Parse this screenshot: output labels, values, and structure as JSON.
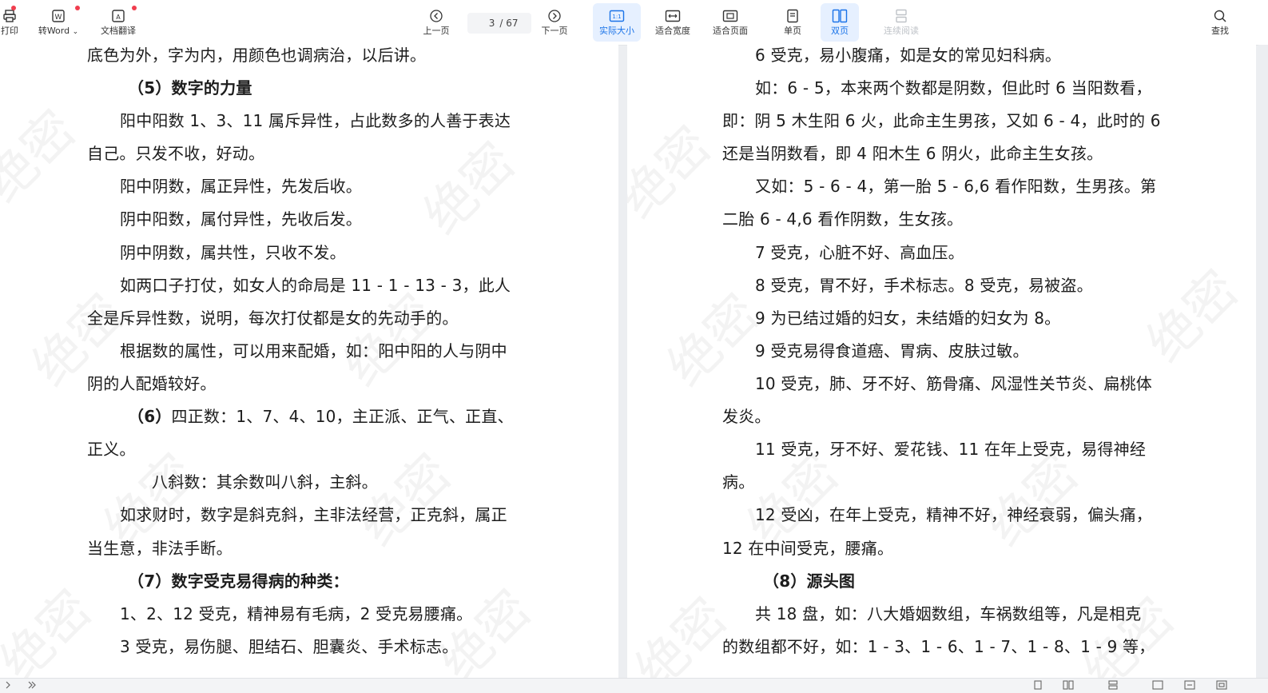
{
  "toolbar": {
    "print": "打印",
    "to_word": "转Word",
    "translate": "文档翻译",
    "prev_page": "上一页",
    "page_current": "3",
    "page_total": "/ 67",
    "next_page": "下一页",
    "actual_size": "实际大小",
    "fit_width": "适合宽度",
    "fit_page": "适合页面",
    "single_page": "单页",
    "double_page": "双页",
    "continuous": "连续阅读",
    "find": "查找"
  },
  "watermark": "绝密",
  "left_page": {
    "lines": [
      "底色为外，字为内，用颜色也调病治，以后讲。",
      "（5）数字的力量",
      "阳中阳数 1、3、11 属斥异性，占此数多的人善于表达",
      "自己。只发不收，好动。",
      "阳中阴数，属正异性，先发后收。",
      "阴中阳数，属付异性，先收后发。",
      "阴中阴数，属共性，只收不发。",
      "如两口子打仗，如女人的命局是 11 - 1 - 13 - 3，此人",
      "全是斥异性数，说明，每次打仗都是女的先动手的。",
      "根据数的属性，可以用来配婚，如：阳中阳的人与阴中",
      "阴的人配婚较好。",
      "（6）",
      "四正数：1、7、4、10，主正派、正气、正直、",
      "正义。",
      "八斜数：其余数叫八斜，主斜。",
      "如求财时，数字是斜克斜，主非法经营，正克斜，属正",
      "当生意，非法手断。",
      "（7）数字受克易得病的种类：",
      "1、2、12 受克，精神易有毛病，2 受克易腰痛。",
      "3 受克，易伤腿、胆结石、胆囊炎、手术标志。"
    ]
  },
  "right_page": {
    "lines": [
      "6 受克，易小腹痛，如是女的常见妇科病。",
      "如：6 - 5，本来两个数都是阴数，但此时 6 当阳数看，",
      "即：阴 5 木生阳 6 火，此命主生男孩，又如 6 - 4，此时的 6",
      "还是当阴数看，即 4 阳木生 6 阴火，此命主生女孩。",
      "又如：5 - 6 - 4，第一胎 5 - 6,6 看作阳数，生男孩。第",
      "二胎 6 - 4,6 看作阴数，生女孩。",
      "7 受克，心脏不好、高血压。",
      "8 受克，胃不好，手术标志。8 受克，易被盗。",
      "9 为已结过婚的妇女，未结婚的妇女为 8。",
      "9 受克易得食道癌、胃病、皮肤过敏。",
      "10 受克，肺、牙不好、筋骨痛、风湿性关节炎、扁桃体",
      "发炎。",
      "11 受克，牙不好、爱花钱、11 在年上受克，易得神经",
      "病。",
      "12 受凶，在年上受克，精神不好，神经衰弱，偏头痛，",
      "12 在中间受克，腰痛。",
      "（8）源头图",
      "共 18 盘，如：八大婚姻数组，车祸数组等，凡是相克",
      "的数组都不好，如：1 - 3、1 - 6、1 - 7、1 - 8、1 - 9 等，"
    ]
  }
}
